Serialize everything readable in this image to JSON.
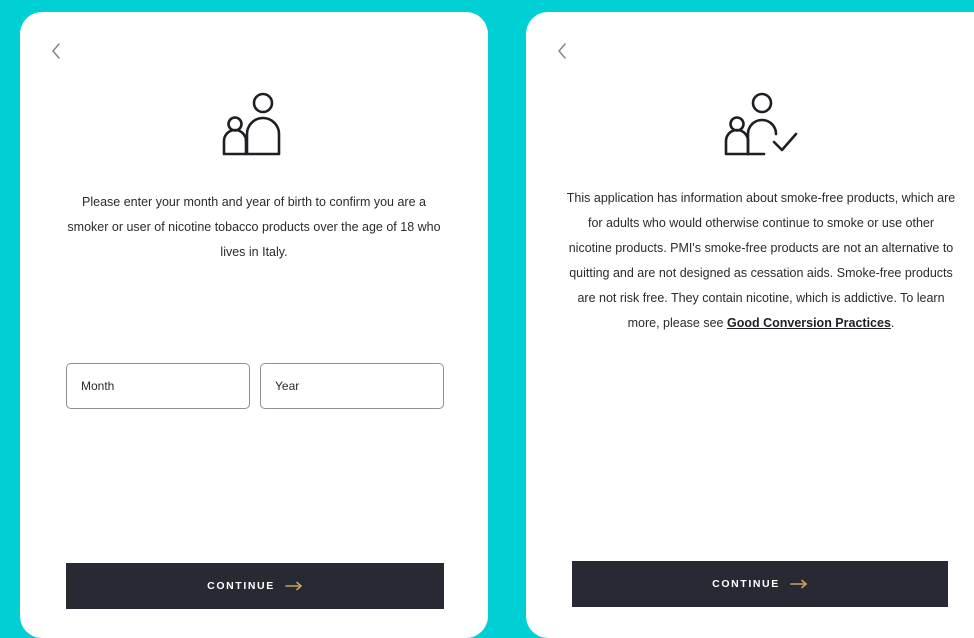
{
  "colors": {
    "background": "#00d0d3",
    "card": "#ffffff",
    "button": "#272a33",
    "button_text": "#ffffff",
    "arrow_accent": "#c9a35a",
    "text": "#2b2b2b"
  },
  "age_gate": {
    "back_icon": "chevron-left-icon",
    "hero_icon": "adult-and-child-icon",
    "message": "Please enter your month and year of birth to confirm you are a smoker or user of nicotine tobacco products over the age of 18 who lives in Italy.",
    "month_placeholder": "Month",
    "year_placeholder": "Year",
    "continue_label": "CONTINUE",
    "continue_icon": "arrow-right-icon"
  },
  "disclaimer": {
    "back_icon": "chevron-left-icon",
    "hero_icon": "adult-and-child-check-icon",
    "message": "This application has information about smoke-free products, which are for adults who would otherwise continue to smoke or use other nicotine products. PMI's smoke-free products are not an alternative to quitting and are not designed as cessation aids. Smoke-free products are not risk free. They contain nicotine, which is addictive. To learn more, please see",
    "link_text": "Good Conversion Practices",
    "link_suffix": ".",
    "continue_label": "CONTINUE",
    "continue_icon": "arrow-right-icon"
  }
}
